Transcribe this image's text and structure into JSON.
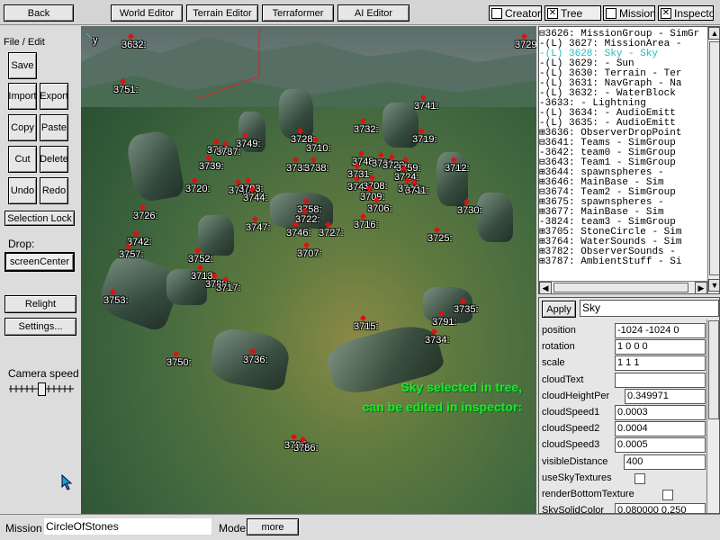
{
  "topbar": {
    "back": "Back",
    "editors": [
      "World Editor",
      "Terrain Editor",
      "Terraformer",
      "AI Editor"
    ],
    "toggles": [
      {
        "label": "Creator",
        "checked": false
      },
      {
        "label": "Tree",
        "checked": true
      },
      {
        "label": "Mission",
        "checked": false
      },
      {
        "label": "Inspector",
        "checked": true
      }
    ]
  },
  "left": {
    "file_edit": "File / Edit",
    "save": "Save",
    "import": "Import",
    "export": "Export",
    "copy": "Copy",
    "paste": "Paste",
    "cut": "Cut",
    "delete": "Delete",
    "undo": "Undo",
    "redo": "Redo",
    "selection_lock": "Selection Lock",
    "drop_label": "Drop:",
    "drop_value": "screenCenter",
    "relight": "Relight",
    "settings": "Settings...",
    "camera_speed": "Camera speed",
    "camera_speed_level": 0.5
  },
  "viewport": {
    "axis_label": "y",
    "annotation_line1": "Sky selected in tree,",
    "annotation_line2": "can be edited in inspector:",
    "markers": [
      "3632:",
      "3729:",
      "3751:",
      "3741:",
      "3732:",
      "3749:",
      "3728:",
      "3710:",
      "3719:",
      "3736:",
      "3737:",
      "3748:",
      "3721:",
      "3723:",
      "3759:",
      "3739:",
      "3733:",
      "3738:",
      "3731:",
      "3724:",
      "3712:",
      "3720:",
      "3740:",
      "3793:",
      "3743:",
      "3708:",
      "3763:",
      "3711:",
      "3744:",
      "3709:",
      "3706:",
      "3726:",
      "3758:",
      "3722:",
      "3716:",
      "3730:",
      "3747:",
      "3746:",
      "3727:",
      "3742:",
      "3725:",
      "3757:",
      "3752:",
      "3707:",
      "3713:",
      "3788:",
      "3717:",
      "3753:",
      "3735:",
      "3715:",
      "3791:",
      "3734:",
      "3750:",
      "3736:",
      "3785:",
      "3786:"
    ]
  },
  "tree": {
    "rows": [
      {
        "text": "⊟3626: MissionGroup - SimGr",
        "selected": false
      },
      {
        "text": "  -(L) 3627: MissionArea - ",
        "selected": false
      },
      {
        "text": "  -(L) 3628: Sky - Sky",
        "selected": true
      },
      {
        "text": "  -(L) 3629:  - Sun",
        "selected": false
      },
      {
        "text": "  -(L) 3630: Terrain - Ter",
        "selected": false
      },
      {
        "text": "  -(L) 3631: NavGraph - Na",
        "selected": false
      },
      {
        "text": "  -(L) 3632:  - WaterBlock",
        "selected": false
      },
      {
        "text": "  -3633:  - Lightning",
        "selected": false
      },
      {
        "text": "  -(L) 3634:  - AudioEmitt",
        "selected": false
      },
      {
        "text": "  -(L) 3635:  - AudioEmitt",
        "selected": false
      },
      {
        "text": "⊞3636: ObserverDropPoint",
        "selected": false
      },
      {
        "text": "⊟3641: Teams - SimGroup",
        "selected": false
      },
      {
        "text": "  -3642: team0 - SimGroup",
        "selected": false
      },
      {
        "text": "  ⊟3643: Team1 - SimGroup",
        "selected": false
      },
      {
        "text": "    ⊞3644: spawnspheres -",
        "selected": false
      },
      {
        "text": "    ⊞3646: MainBase - Sim",
        "selected": false
      },
      {
        "text": "  ⊟3674: Team2 - SimGroup",
        "selected": false
      },
      {
        "text": "    ⊞3675: spawnspheres -",
        "selected": false
      },
      {
        "text": "    ⊞3677: MainBase - Sim",
        "selected": false
      },
      {
        "text": "  -3824: team3 - SimGroup",
        "selected": false
      },
      {
        "text": "⊞3705: StoneCircle - Sim",
        "selected": false
      },
      {
        "text": "⊞3764: WaterSounds - Sim",
        "selected": false
      },
      {
        "text": "⊞3782: ObserverSounds -",
        "selected": false
      },
      {
        "text": "⊞3787: AmbientStuff - Si",
        "selected": false
      }
    ]
  },
  "inspector": {
    "apply": "Apply",
    "object_name": "Sky",
    "fields": [
      {
        "label": "position",
        "value": "-1024 -1024 0"
      },
      {
        "label": "rotation",
        "value": "1 0 0 0"
      },
      {
        "label": "scale",
        "value": "1 1 1"
      },
      {
        "label": "cloudText",
        "value": ""
      },
      {
        "label": "cloudHeightPer",
        "value": "0.349971"
      },
      {
        "label": "cloudSpeed1",
        "value": "0.0003"
      },
      {
        "label": "cloudSpeed2",
        "value": "0.0004"
      },
      {
        "label": "cloudSpeed3",
        "value": "0.0005"
      },
      {
        "label": "visibleDistance",
        "value": "400"
      }
    ],
    "checks": [
      {
        "label": "useSkyTextures",
        "checked": false
      },
      {
        "label": "renderBottomTexture",
        "checked": false
      }
    ],
    "last_field": {
      "label": "SkySolidColor",
      "value": "0.080000 0.250"
    }
  },
  "bottom": {
    "mission_label": "Mission",
    "mission_value": "CircleOfStones",
    "mode_label": "Mode",
    "more": "more"
  },
  "colors": {
    "annotation": "#22e622",
    "marker": "#e01010",
    "selected_tree_row": "#22bbbb"
  }
}
